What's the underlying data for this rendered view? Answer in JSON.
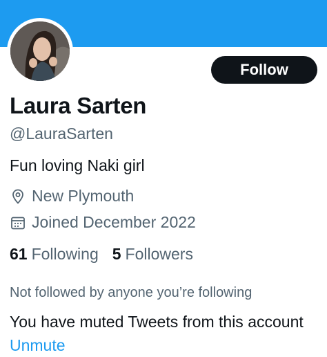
{
  "profile": {
    "name": "Laura Sarten",
    "handle": "@LauraSarten",
    "bio": "Fun loving Naki girl",
    "location": "New Plymouth",
    "joined": "Joined December 2022",
    "following_count": "61",
    "following_label": "Following",
    "followers_count": "5",
    "followers_label": "Followers"
  },
  "actions": {
    "follow_label": "Follow"
  },
  "notices": {
    "not_followed": "Not followed by anyone you’re following",
    "muted_text": "You have muted Tweets from this account",
    "unmute_label": "Unmute"
  },
  "colors": {
    "banner": "#1d9bf0",
    "link": "#1d9bf0",
    "button_bg": "#0f1419",
    "secondary_text": "#536471"
  },
  "icons": {
    "location": "location-pin-icon",
    "joined": "calendar-icon"
  }
}
